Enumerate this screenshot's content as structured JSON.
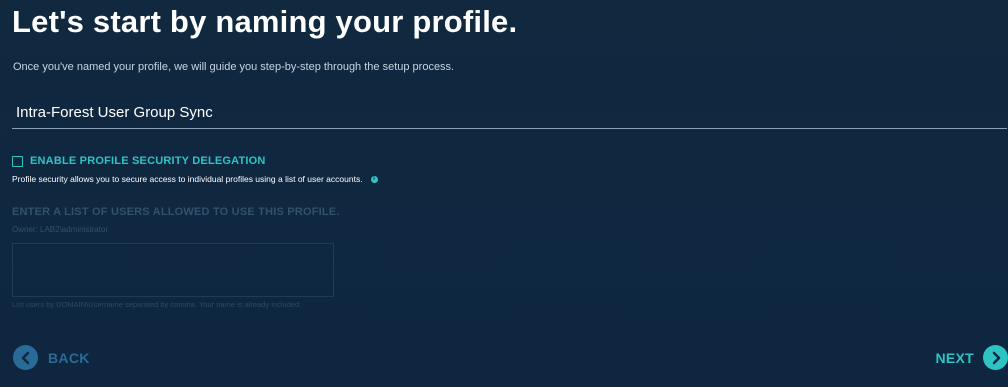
{
  "header": {
    "title": "Let's start by naming your profile.",
    "subtitle": "Once you've named your profile, we will guide you step-by-step through the setup process."
  },
  "profile_name": {
    "value": "Intra-Forest User Group Sync"
  },
  "security": {
    "checkbox_label": "ENABLE PROFILE SECURITY DELEGATION",
    "checked": false,
    "help_text": "Profile security allows you to secure access to individual profiles using a list of user accounts.",
    "info_icon": "info-icon"
  },
  "users": {
    "heading": "ENTER A LIST OF USERS ALLOWED TO USE THIS PROFILE.",
    "owner": "Owner: LAB2\\administrator",
    "value": "",
    "hint": "List users by DOMAIN\\Username separated by comma. Your name is already included."
  },
  "navigation": {
    "back_label": "BACK",
    "next_label": "NEXT",
    "back_icon": "chevron-left-icon",
    "next_icon": "chevron-right-icon"
  },
  "colors": {
    "background": "#0f2742",
    "accent": "#2ec4c4",
    "disabled_accent": "#2a6a96"
  }
}
